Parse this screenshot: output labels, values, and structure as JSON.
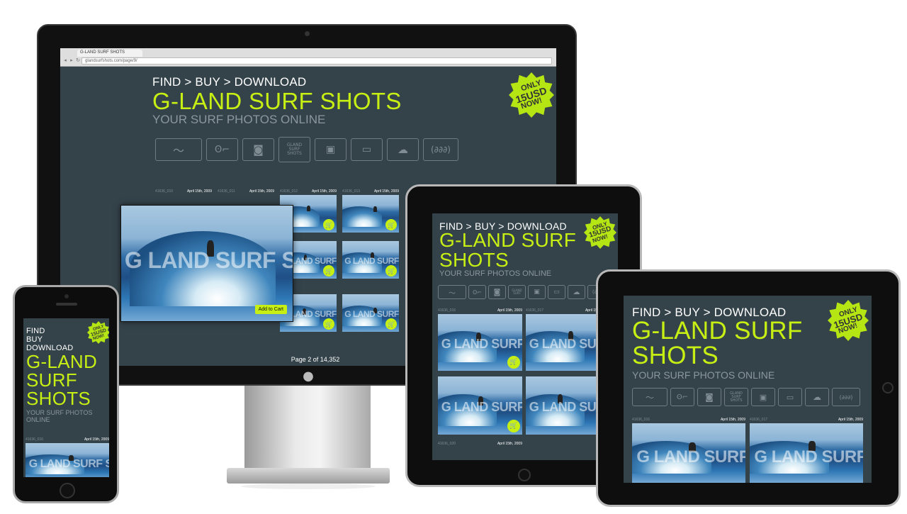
{
  "site": {
    "tagline": "FIND > BUY > DOWNLOAD",
    "tagline_stacked": [
      "FIND",
      "BUY",
      "DOWNLOAD"
    ],
    "title": "G-LAND SURF SHOTS",
    "title_two_line": [
      "G-LAND SURF",
      "SHOTS"
    ],
    "title_three_line": [
      "G-LAND",
      "SURF",
      "SHOTS"
    ],
    "subtitle": "YOUR SURF PHOTOS ONLINE",
    "subtitle_two_line": [
      "YOUR SURF PHOTOS",
      "ONLINE"
    ],
    "badge": [
      "ONLY",
      "15USD",
      "NOW!"
    ],
    "watermark": "G LAND SURF SHOTS",
    "icon_logo_text": [
      "GLAND",
      "SURF",
      "SHOTS"
    ],
    "accent_color": "#c7ef14",
    "background_color": "#34434a"
  },
  "browser": {
    "tab_label": "G-LAND SURF SHOTS",
    "address": "glandsurfshots.com/page/9/"
  },
  "icons": [
    "wave-icon",
    "surfer-icon",
    "camera-icon",
    "logo-icon",
    "slideshow-icon",
    "credit-card-icon",
    "cloud-download-icon",
    "dollar-coins-icon"
  ],
  "photo_date": "April 15th, 2009",
  "desktop": {
    "thumbs": [
      {
        "id": "41636_010",
        "date": "April 15th, 2009"
      },
      {
        "id": "41636_011",
        "date": "April 15th, 2009"
      },
      {
        "id": "41636_012",
        "date": "April 15th, 2009"
      },
      {
        "id": "41636_013",
        "date": "April 15th, 2009"
      }
    ],
    "add_to_cart": "Add to Cart",
    "pager": "Page 2 of 14,352"
  },
  "tablet_portrait": {
    "thumbs": [
      {
        "id": "41636_016",
        "date": "April 15th, 2009"
      },
      {
        "id": "41636_017",
        "date": "April 15th, 2009"
      }
    ]
  },
  "tablet_landscape": {
    "thumbs": [
      {
        "id": "41636_016",
        "date": "April 15th, 2009"
      },
      {
        "id": "41636_017",
        "date": "April 15th, 2009"
      }
    ]
  },
  "phone": {
    "thumb": {
      "id": "41636_016",
      "date": "April 15th, 2009"
    }
  }
}
